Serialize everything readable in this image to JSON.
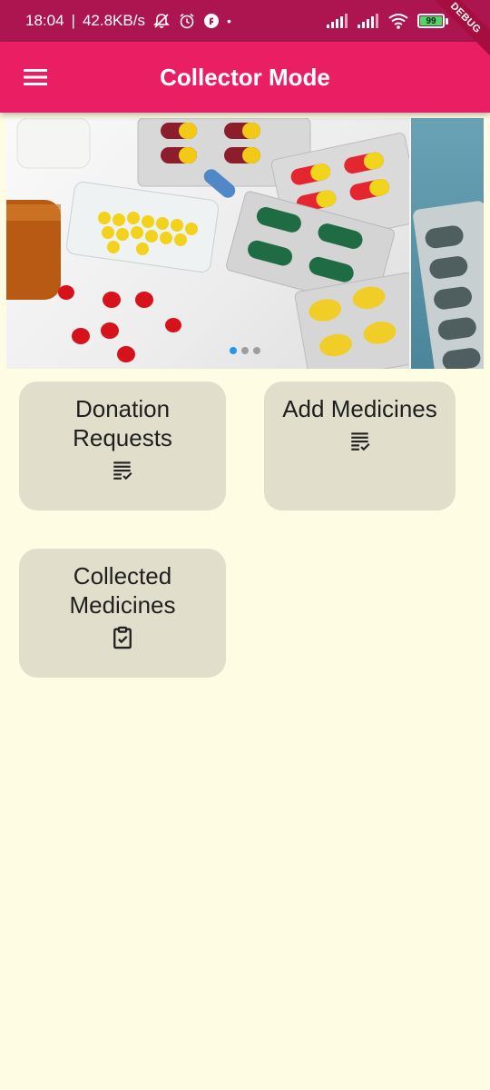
{
  "status_bar": {
    "time": "18:04",
    "speed": "42.8KB/s",
    "battery": "99",
    "debug_label": "DEBUG"
  },
  "app_bar": {
    "title": "Collector Mode",
    "menu_icon": "menu-icon"
  },
  "carousel": {
    "slide_count": 3,
    "active_index": 0
  },
  "cards": [
    {
      "label": "Donation\nRequests",
      "icon": "list-check-icon"
    },
    {
      "label": "Add Medicines",
      "icon": "list-check-icon"
    },
    {
      "label": "Collected\nMedicines",
      "icon": "clipboard-check-icon"
    }
  ]
}
